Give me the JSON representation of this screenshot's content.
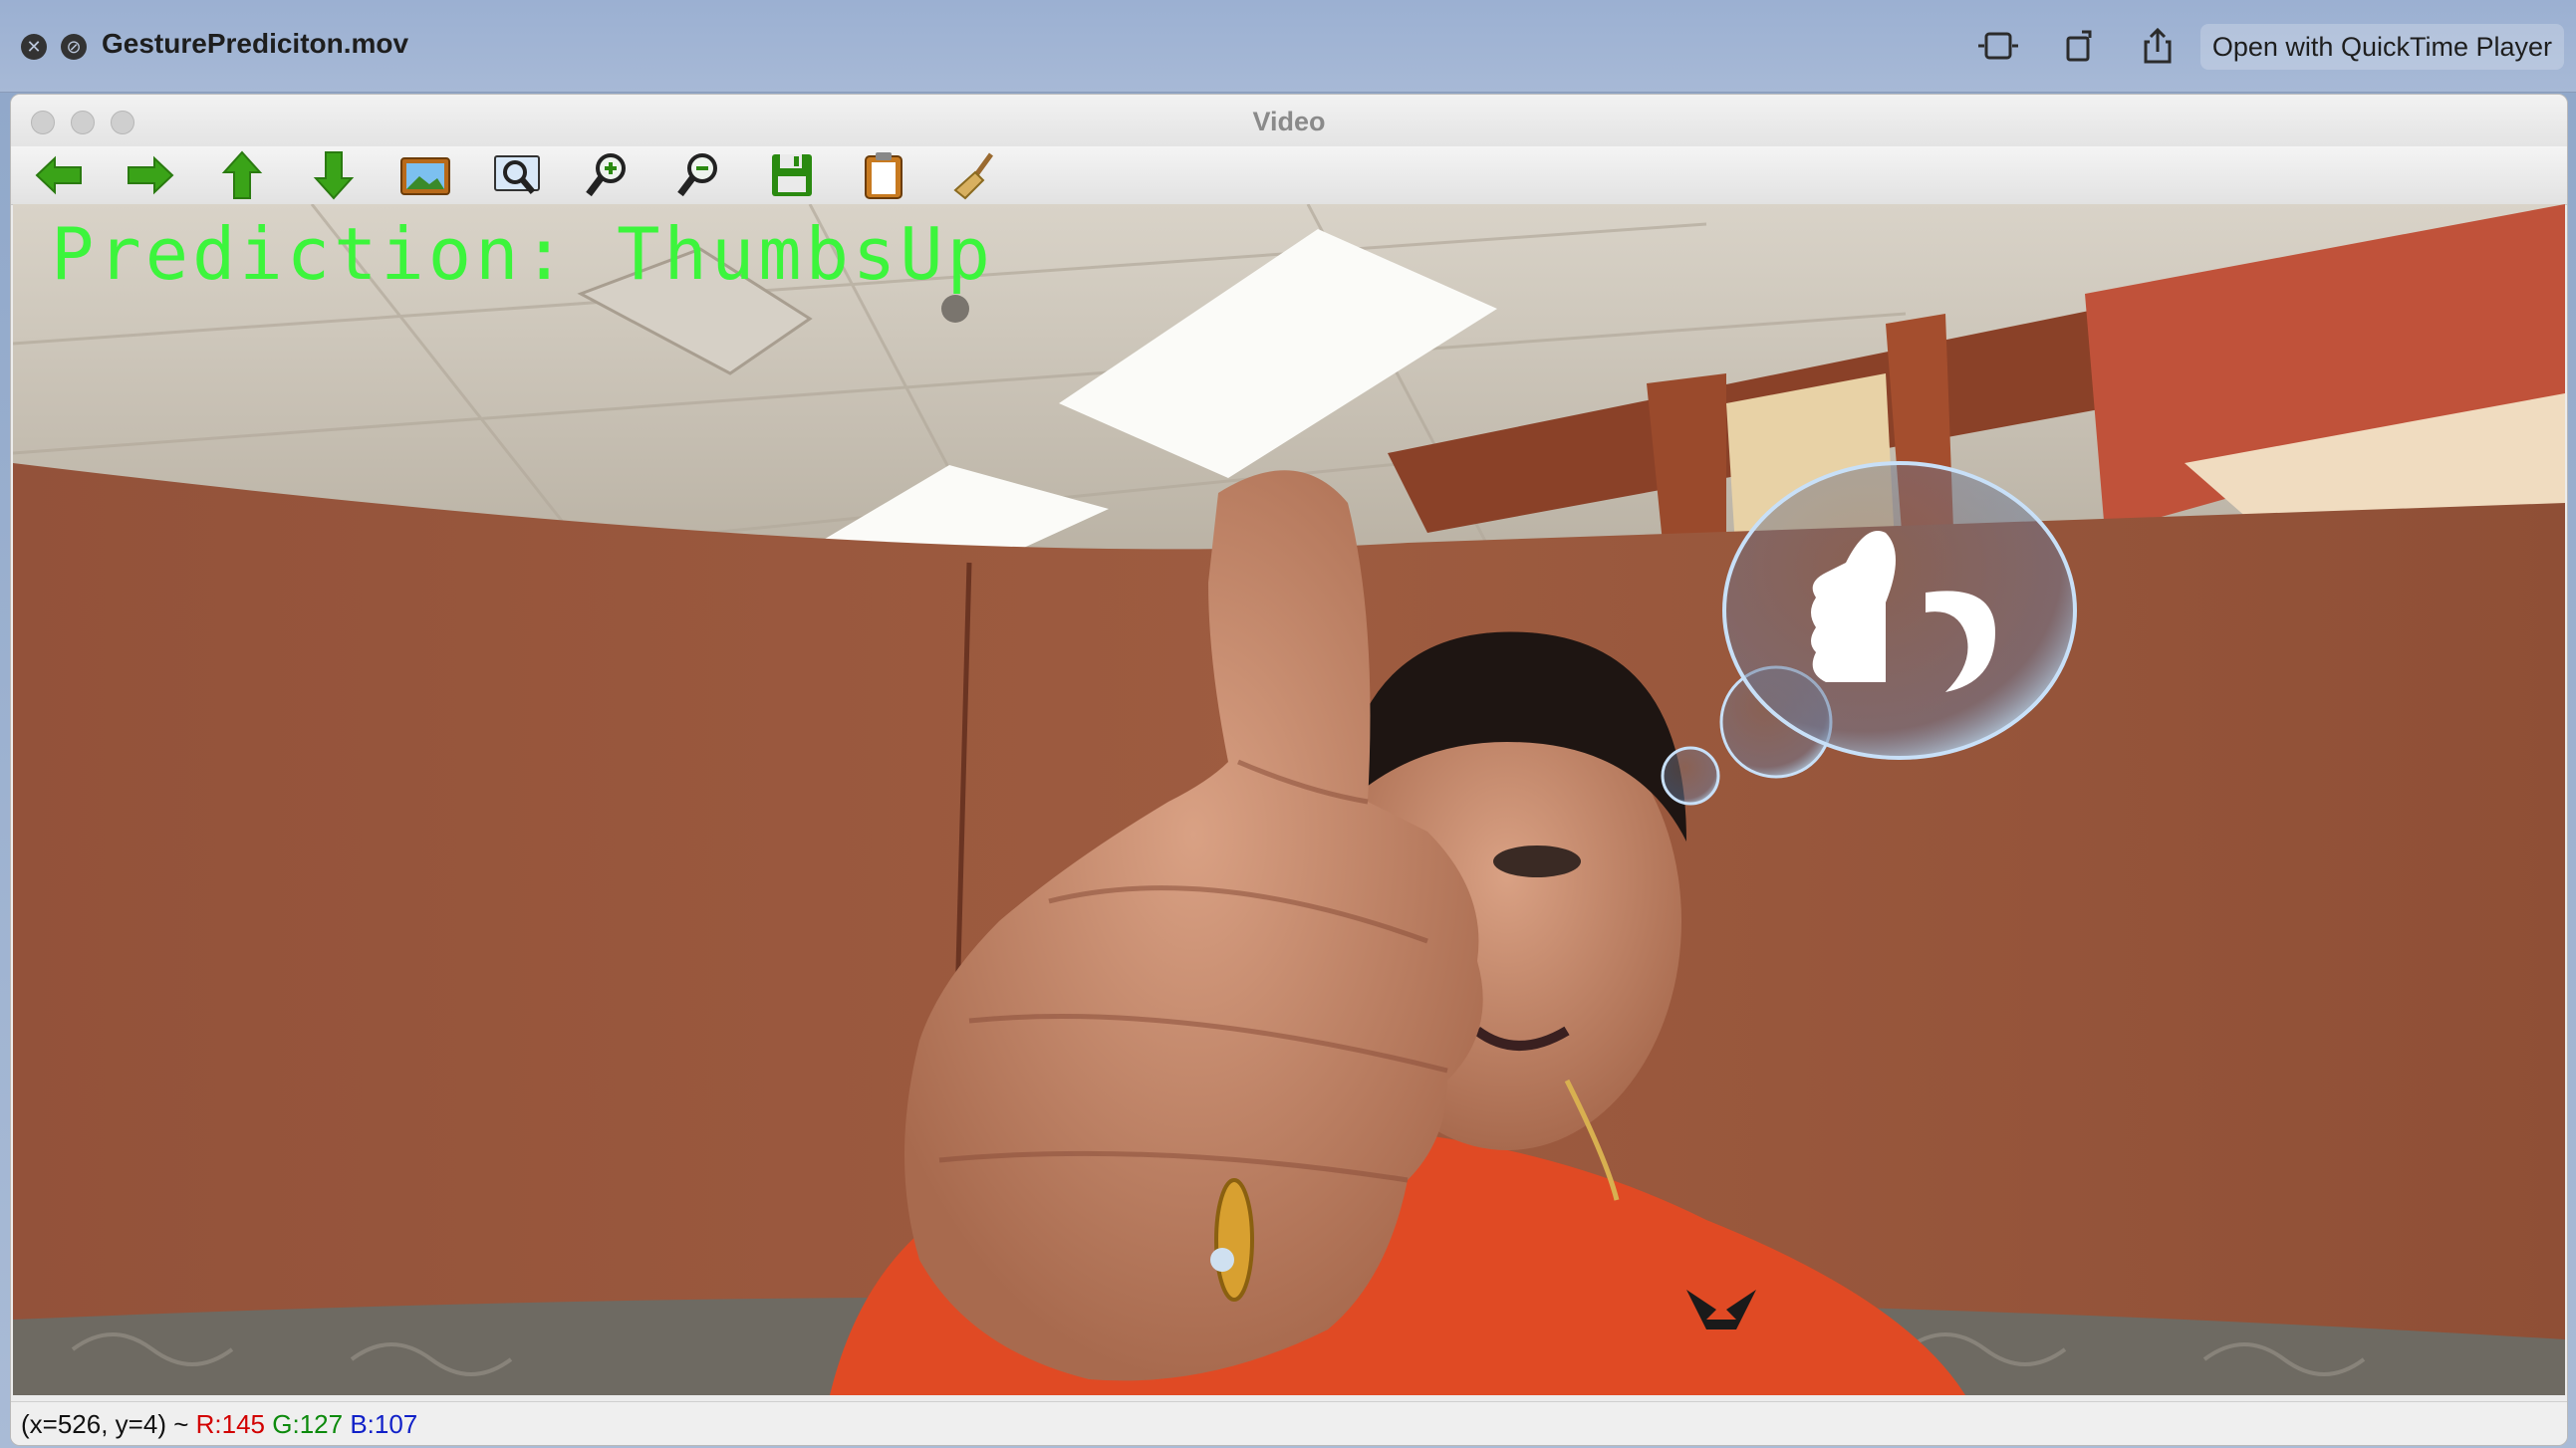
{
  "quicklook": {
    "file_name": "GesturePrediciton.mov",
    "open_button": "Open with QuickTime Player",
    "icons": [
      "close-icon",
      "markup-icon",
      "trim-icon",
      "rotate-icon",
      "share-icon"
    ]
  },
  "window": {
    "title": "Video",
    "toolbar_icons": [
      "arrow-left-icon",
      "arrow-right-icon",
      "arrow-up-icon",
      "arrow-down-icon",
      "image-icon",
      "zoom-fit-icon",
      "zoom-in-icon",
      "zoom-out-icon",
      "save-icon",
      "clipboard-icon",
      "broom-icon"
    ]
  },
  "video": {
    "prediction_text": "Prediction: ThumbsUp",
    "accent_color": "#3cf53c"
  },
  "status": {
    "position": "(x=526, y=4) ~",
    "r": "R:145",
    "g": "G:127",
    "b": "B:107"
  }
}
